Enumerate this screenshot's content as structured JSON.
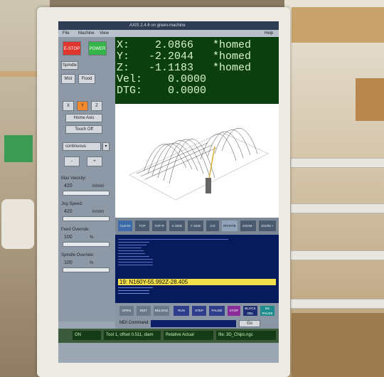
{
  "window": {
    "title": "AXIS 2.4.6 on green-machine",
    "menus": [
      "File",
      "Machine",
      "View"
    ],
    "help": "Help"
  },
  "controls": {
    "estop": "E-STOP",
    "power": "POWER",
    "spindle": "Spindle",
    "mist": "Mist",
    "flood": "Flood",
    "axes": [
      "X",
      "Y",
      "Z"
    ],
    "home_axis": "Home Axis",
    "touch_off": "Touch Off",
    "jog_mode": "continuous",
    "minus": "-",
    "plus": "+"
  },
  "sliders": {
    "max_velocity_label": "Max Velocity:",
    "max_velocity_value": "420",
    "max_velocity_unit": "in/min",
    "jog_speed_label": "Jog Speed:",
    "jog_speed_value": "420",
    "jog_speed_unit": "in/min",
    "feed_override_label": "Feed Override:",
    "feed_override_value": "100",
    "feed_override_unit": "%",
    "spindle_override_label": "Spindle Override:",
    "spindle_override_value": "100",
    "spindle_override_unit": "%"
  },
  "dro": {
    "x": "X:    2.0866   *homed",
    "y": "Y:   -2.2044   *homed",
    "z": "Z:   -1.1183   *homed",
    "vel": "Vel:    0.0000",
    "dtg": "DTG:    0.0000"
  },
  "view_buttons": [
    "CLEAN PLOT",
    "TOP",
    "TOP R",
    "X SIDE",
    "Y SIDE",
    "3-D",
    "ROTATE",
    "ZOOM -",
    "ZOOM +"
  ],
  "gcode": {
    "active_line": "19: N160Y-55.992Z-28.405"
  },
  "run_buttons": [
    "OPEN",
    "EDIT",
    "RELOAD",
    "RUN",
    "STEP",
    "PAUSE",
    "STOP",
    "BLOCK DEL",
    "M1 PAUSE"
  ],
  "mdi": {
    "label": "MDI Command:",
    "go": "Go"
  },
  "status": {
    "state": "ON",
    "tool": "Tool 1, offset 0.511, diam",
    "position": "Relative Actual",
    "file": "file: 3D_Chips.ngc"
  }
}
